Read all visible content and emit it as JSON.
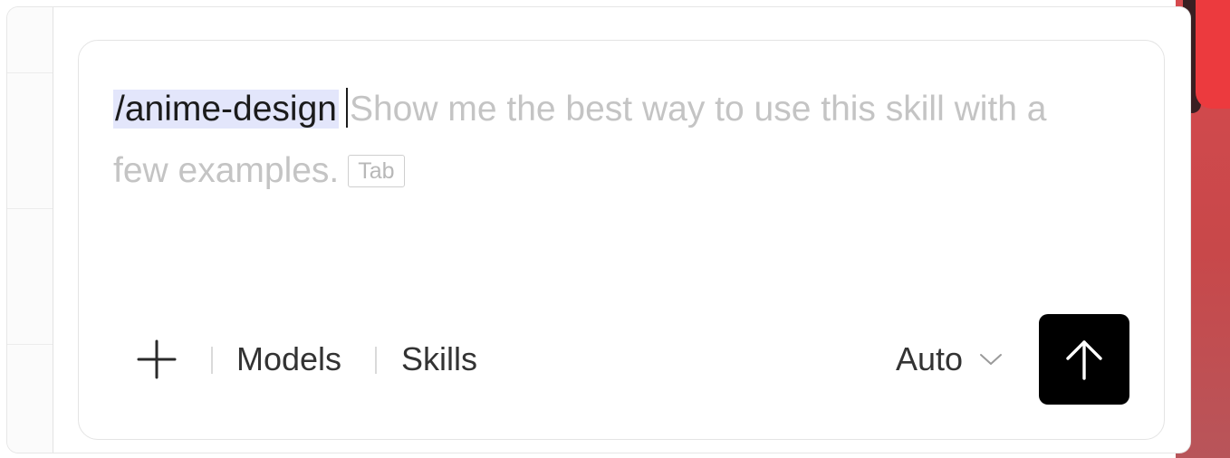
{
  "composer": {
    "skill_token": "/anime-design",
    "suggestion": "Show me the best way to use this skill with a few examples.",
    "tab_hint": "Tab"
  },
  "toolbar": {
    "add_icon": "plus-icon",
    "models_label": "Models",
    "skills_label": "Skills",
    "mode_value": "Auto",
    "mode_icon": "chevron-down-icon",
    "send_icon": "arrow-up-icon"
  },
  "colors": {
    "send_button_bg": "#000000",
    "skill_token_highlight": "#e3e6fb",
    "placeholder_text": "#c4c4c4",
    "backdrop_accent": "#d64a4e"
  }
}
